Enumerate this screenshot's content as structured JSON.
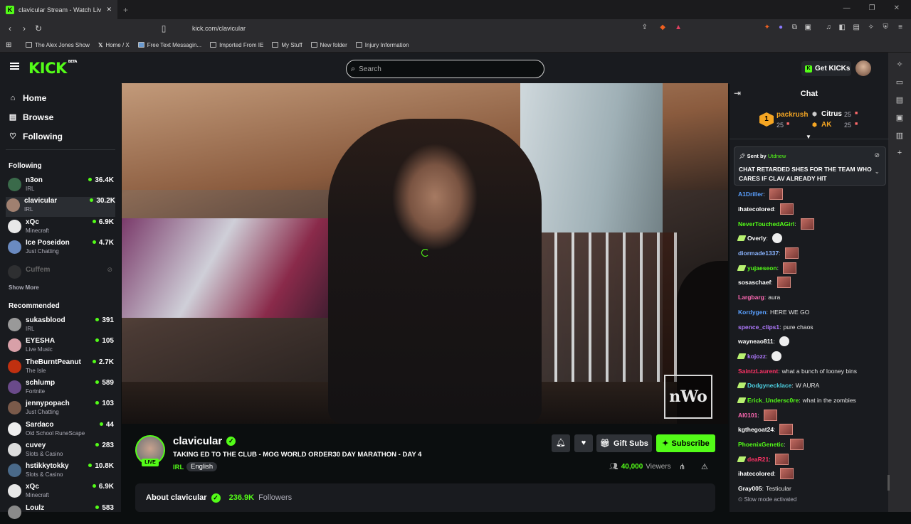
{
  "browser": {
    "tab_title": "clavicular Stream - Watch Liv",
    "url": "kick.com/clavicular",
    "new_tab": "+",
    "bookmarks": [
      "The Alex Jones Show",
      "Home / X",
      "Free Text Messagin...",
      "Imported From IE",
      "My Stuff",
      "New folder",
      "Injury Information"
    ]
  },
  "header": {
    "logo": "KICK",
    "logo_sup": "BETA",
    "search_placeholder": "Search",
    "get_kicks": "Get KICKs"
  },
  "sidebar": {
    "nav": [
      {
        "label": "Home",
        "icon": "home-icon"
      },
      {
        "label": "Browse",
        "icon": "browse-icon"
      },
      {
        "label": "Following",
        "icon": "heart-icon"
      }
    ],
    "following_title": "Following",
    "following": [
      {
        "name": "n3on",
        "category": "IRL",
        "viewers": "36.4K",
        "color": "#3a6a4a"
      },
      {
        "name": "clavicular",
        "category": "IRL",
        "viewers": "30.2K",
        "color": "#a08070"
      },
      {
        "name": "xQc",
        "category": "Minecraft",
        "viewers": "6.9K",
        "color": "#e8e8e8"
      },
      {
        "name": "Ice Poseidon",
        "category": "Just Chatting",
        "viewers": "4.7K",
        "color": "#6a8ac0"
      }
    ],
    "offline": "Cuffem",
    "show_more": "Show More",
    "recommended_title": "Recommended",
    "recommended": [
      {
        "name": "sukasblood",
        "category": "IRL",
        "viewers": "391",
        "color": "#999"
      },
      {
        "name": "EYESHA",
        "category": "Live Music",
        "viewers": "105",
        "color": "#d8a0a8"
      },
      {
        "name": "TheBurntPeanut",
        "category": "The Isle",
        "viewers": "2.7K",
        "color": "#c03010"
      },
      {
        "name": "schlump",
        "category": "Fortnite",
        "viewers": "589",
        "color": "#6a4a8a"
      },
      {
        "name": "jennypopach",
        "category": "Just Chatting",
        "viewers": "103",
        "color": "#7a5a4a"
      },
      {
        "name": "Sardaco",
        "category": "Old School RuneScape",
        "viewers": "44",
        "color": "#eee"
      },
      {
        "name": "cuvey",
        "category": "Slots & Casino",
        "viewers": "283",
        "color": "#ddd"
      },
      {
        "name": "hstikkytokky",
        "category": "Slots & Casino",
        "viewers": "10.8K",
        "color": "#4a6a8a"
      },
      {
        "name": "xQc",
        "category": "Minecraft",
        "viewers": "6.9K",
        "color": "#e8e8e8"
      },
      {
        "name": "Loulz",
        "category": "",
        "viewers": "583",
        "color": "#8a8a8a"
      }
    ]
  },
  "stream": {
    "watermark": "nWo",
    "channel": "clavicular",
    "live": "LIVE",
    "title": "TAKING ED TO THE CLUB - MOG WORLD ORDER30 DAY MARATHON - DAY 4",
    "category": "IRL",
    "tag": "English",
    "gift_subs": "Gift Subs",
    "subscribe": "Subscribe",
    "viewers_num": "0,000",
    "viewers_lead": "4",
    "viewers_label": "Viewers",
    "about": "About clavicular",
    "followers_count": "236.9K",
    "followers_label": "Followers"
  },
  "chat": {
    "title": "Chat",
    "leaderboard": {
      "first": {
        "name": "packrush",
        "count": "25",
        "color": "#f5a623"
      },
      "second": {
        "name": "Citrus",
        "count": "25",
        "color": "#ffffff"
      },
      "third": {
        "name": "AK",
        "count": "25",
        "color": "#f5a623"
      }
    },
    "pinned_by_label": "Sent by",
    "pinned_by_user": "Utdnew",
    "pinned_msg": "CHAT RETARDED SHES FOR THE TEAM WHO CARES IF CLAV ALREADY HIT",
    "messages": [
      {
        "user": "A1Driller",
        "color": "#5aa0ff",
        "text": "",
        "emote": "face",
        "badge": false
      },
      {
        "user": "ihatecolored",
        "color": "#ffffff",
        "text": "",
        "emote": "face",
        "badge": false
      },
      {
        "user": "NeverTouchedAGirl",
        "color": "#53fc18",
        "text": "",
        "emote": "face",
        "badge": false
      },
      {
        "user": "Overly",
        "color": "#ffffff",
        "text": "",
        "emote": "round",
        "badge": true
      },
      {
        "user": "diormade1337",
        "color": "#8ab4ff",
        "text": "",
        "emote": "face",
        "badge": false
      },
      {
        "user": "yujaeseon",
        "color": "#53fc18",
        "text": "",
        "emote": "face",
        "badge": true
      },
      {
        "user": "sosaschaef",
        "color": "#ffffff",
        "text": "",
        "emote": "face",
        "badge": false
      },
      {
        "user": "Largbarg",
        "color": "#ff69b4",
        "text": "aura",
        "emote": "",
        "badge": false
      },
      {
        "user": "Kordygen",
        "color": "#5aa0ff",
        "text": "HERE WE GO",
        "emote": "",
        "badge": false
      },
      {
        "user": "spence_clips1",
        "color": "#b07aff",
        "text": "pure chaos",
        "emote": "",
        "badge": false
      },
      {
        "user": "wayneao811",
        "color": "#ffffff",
        "text": "",
        "emote": "round",
        "badge": false
      },
      {
        "user": "kojozz",
        "color": "#b07aff",
        "text": "",
        "emote": "round",
        "badge": true
      },
      {
        "user": "SaintzLaurent",
        "color": "#ff3366",
        "text": "what a bunch of looney bins",
        "emote": "",
        "badge": false
      },
      {
        "user": "Dodgynecklace",
        "color": "#4dd0e1",
        "text": "W AURA",
        "emote": "",
        "badge": true
      },
      {
        "user": "Erick_Undersc0re",
        "color": "#53fc18",
        "text": "what in the zombies",
        "emote": "",
        "badge": true
      },
      {
        "user": "Al0101",
        "color": "#ff69b4",
        "text": "",
        "emote": "face",
        "badge": false
      },
      {
        "user": "kgthegoat24",
        "color": "#ffffff",
        "text": "",
        "emote": "face",
        "badge": false
      },
      {
        "user": "PhoenixGenetic",
        "color": "#53fc18",
        "text": "",
        "emote": "face",
        "badge": false
      },
      {
        "user": "deaR21",
        "color": "#ff3366",
        "text": "",
        "emote": "face",
        "badge": true
      },
      {
        "user": "ihatecolored",
        "color": "#ffffff",
        "text": "",
        "emote": "face",
        "badge": false
      },
      {
        "user": "Gray005",
        "color": "#ffffff",
        "text": "Testicular",
        "emote": "",
        "badge": false
      }
    ],
    "slow_mode": "Slow mode activated"
  }
}
